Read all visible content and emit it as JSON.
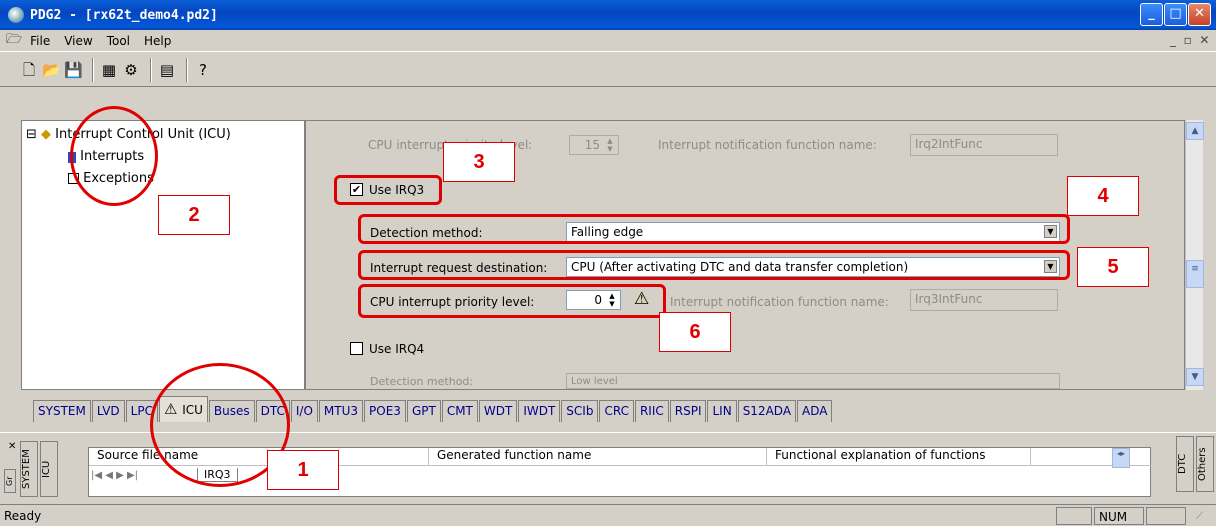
{
  "window": {
    "title": "PDG2 - [rx62t_demo4.pd2]"
  },
  "menu": {
    "file": "File",
    "view": "View",
    "tool": "Tool",
    "help": "Help"
  },
  "tree": {
    "root": "Interrupt Control Unit (ICU)",
    "items": [
      "Interrupts",
      "Exceptions"
    ]
  },
  "form": {
    "irq2_priority_label": "CPU interrupt priority level:",
    "irq2_priority_value": "15",
    "irq2_notify_label": "Interrupt notification function name:",
    "irq2_notify_value": "Irq2IntFunc",
    "use_irq3_label": "Use IRQ3",
    "use_irq3_checked": true,
    "detection_label": "Detection method:",
    "detection_value": "Falling edge",
    "destination_label": "Interrupt request destination:",
    "destination_value": "CPU (After activating DTC and data transfer completion)",
    "priority_label": "CPU interrupt priority level:",
    "priority_value": "0",
    "notify_label": "Interrupt notification function name:",
    "notify_value": "Irq3IntFunc",
    "use_irq4_label": "Use IRQ4",
    "irq4_detection_label": "Detection method:",
    "irq4_detection_value": "Low level"
  },
  "tabs": [
    "SYSTEM",
    "LVD",
    "LPC",
    "ICU",
    "Buses",
    "DTC",
    "I/O",
    "MTU3",
    "POE3",
    "GPT",
    "CMT",
    "WDT",
    "IWDT",
    "SCIb",
    "CRC",
    "RIIC",
    "RSPI",
    "LIN",
    "S12ADA",
    "ADA"
  ],
  "active_tab": "ICU",
  "output": {
    "vtabs_left": [
      "SYSTEM",
      "ICU"
    ],
    "columns": [
      "Source file name",
      "Generated function name",
      "Functional explanation of functions"
    ],
    "sheet_tab": "IRQ3",
    "vtabs_right": [
      "DTC",
      "Others"
    ]
  },
  "status": {
    "text": "Ready",
    "num": "NUM"
  },
  "callouts": [
    "1",
    "2",
    "3",
    "4",
    "5",
    "6"
  ],
  "colors": {
    "title": "#0a5fd8",
    "annotation": "#e00000",
    "tab_text": "#00008b"
  }
}
